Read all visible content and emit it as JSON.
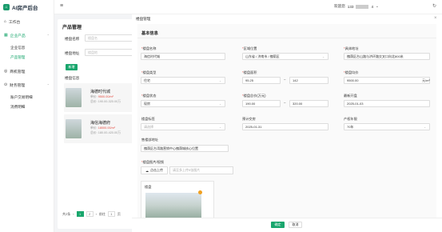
{
  "app": {
    "title": "AI房产后台",
    "logo_letter": "AI"
  },
  "sidebar": {
    "items": [
      {
        "label": "工作台",
        "icon": "home-icon"
      },
      {
        "label": "企业产品",
        "icon": "product-icon",
        "expanded": true
      },
      {
        "label": "企业信息"
      },
      {
        "label": "产品管理"
      },
      {
        "label": "商机管理",
        "icon": "opportunity-icon"
      },
      {
        "label": "财务管理",
        "icon": "finance-icon",
        "expanded": true
      },
      {
        "label": "账户交易明细"
      },
      {
        "label": "消费明细"
      }
    ]
  },
  "topbar": {
    "greeting": "欢迎您",
    "phone": "133",
    "phone_suffix": "4"
  },
  "list_panel": {
    "title": "产品管理",
    "filters": [
      {
        "label": "楼盘名称",
        "placeholder": "楼盘名"
      },
      {
        "label": "楼盘地址",
        "placeholder": "楼盘地"
      }
    ],
    "add_label": "新增",
    "info_title": "楼盘信息",
    "cards": [
      {
        "name": "海德时代城",
        "price_label": "单价:",
        "price": "9500.00/m²",
        "total": "总价: 190.00-320.00万"
      },
      {
        "name": "海信海德府",
        "price_label": "单价:",
        "price": "18000.00/m²",
        "total": "总价: 180.00-420.00万"
      }
    ],
    "pagination": {
      "total": "共2条",
      "pages": [
        "1",
        "2"
      ],
      "goto": "前往",
      "current": "1",
      "page_unit": "页"
    }
  },
  "dialog": {
    "title": "楼盘管理",
    "section": "基本信息",
    "fields": {
      "name": {
        "label": "楼盘名称",
        "value": "海信时代城",
        "required": true
      },
      "area": {
        "label": "区域位置",
        "value": "山东省 / 济南市 / 槐荫区",
        "required": true
      },
      "address": {
        "label": "具体地址",
        "value": "槐荫区台山路与济环路交叉口向北800米",
        "required": true
      },
      "type": {
        "label": "楼盘类型",
        "value": "住宅",
        "required": true
      },
      "area_size": {
        "label": "楼盘面积",
        "min": "95.25",
        "max": "142",
        "required": true
      },
      "unit_price": {
        "label": "楼盘均价",
        "value": "9500.00",
        "unit": "元/m²",
        "required": true
      },
      "status": {
        "label": "楼盘状态",
        "value": "现房",
        "required": true
      },
      "total_price": {
        "label": "楼盘总价(万元)",
        "min": "190.00",
        "max": "320.00",
        "required": true
      },
      "open_time": {
        "label": "最新开盘",
        "value": "2025-01-03"
      },
      "tags": {
        "label": "楼盘标签",
        "placeholder": "请选择"
      },
      "delivery": {
        "label": "预计交房",
        "value": "2025-01-31"
      },
      "years": {
        "label": "产权年限",
        "value": "70年"
      },
      "sales_address": {
        "label": "售楼部地址",
        "value": "槐荫区台湾路营销中心槐荫城核心位置"
      },
      "images": {
        "label": "楼盘图片/视频",
        "upload_label": "点击上传",
        "hint": "请至多上传9张图片",
        "group": "楼盘"
      }
    },
    "ok_label": "确定",
    "cancel_label": "取消"
  },
  "colors": {
    "accent": "#19a66d",
    "price": "#e54d42"
  }
}
